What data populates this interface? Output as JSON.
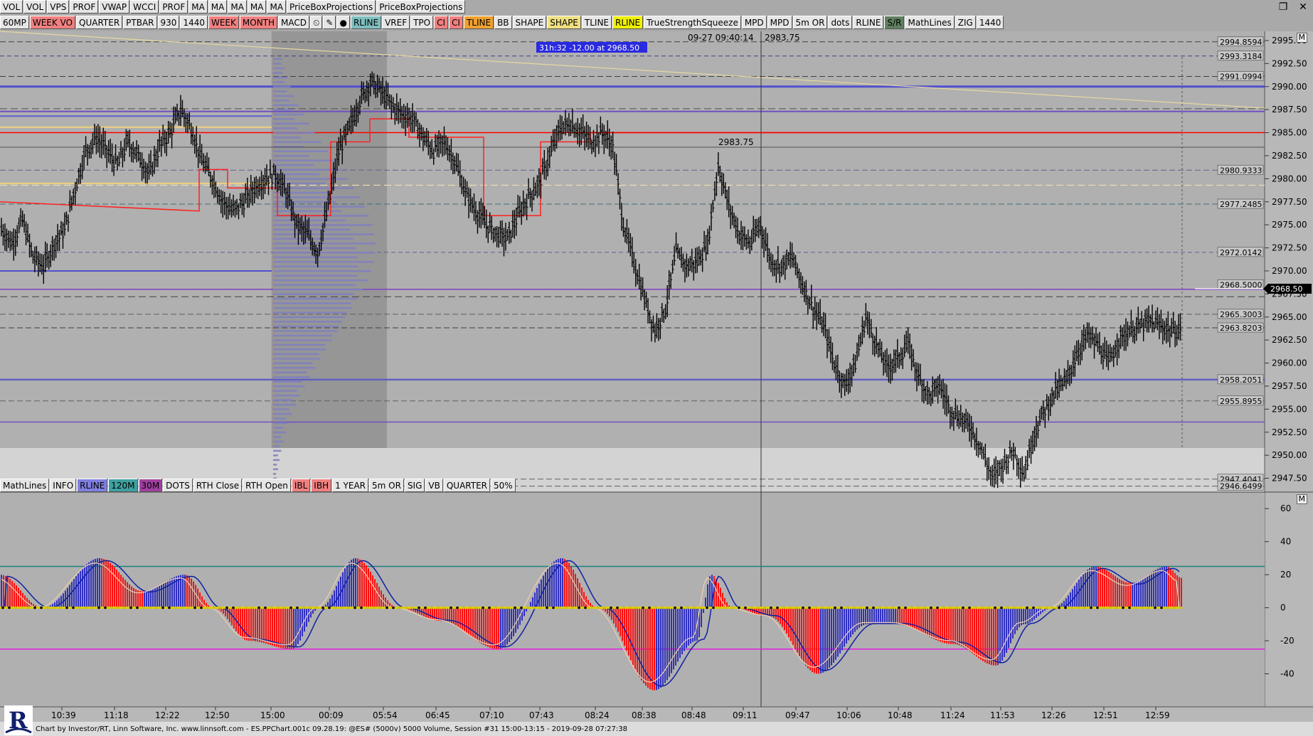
{
  "toolbar_top": [
    "VOL",
    "VOL",
    "VPS",
    "PROF",
    "VWAP",
    "WCCI",
    "PROF",
    "MA",
    "MA",
    "MA",
    "MA",
    "MA",
    "PriceBoxProjections",
    "PriceBoxProjections"
  ],
  "toolbar_second": [
    {
      "label": "60MP",
      "bg": "#e6e6e6"
    },
    {
      "label": "WEEK VO",
      "bg": "#f08080"
    },
    {
      "label": "QUARTER",
      "bg": "#e6e6e6"
    },
    {
      "label": "PTBAR",
      "bg": "#e6e6e6"
    },
    {
      "label": "930",
      "bg": "#e6e6e6"
    },
    {
      "label": "1440",
      "bg": "#e6e6e6"
    },
    {
      "label": "WEEK",
      "bg": "#f08080"
    },
    {
      "label": "MONTH",
      "bg": "#f08080"
    },
    {
      "label": "MACD",
      "bg": "#e6e6e6"
    },
    {
      "label": "⏲",
      "bg": "#e6e6e6"
    },
    {
      "label": "✎",
      "bg": "#e6e6e6"
    },
    {
      "label": "●",
      "bg": "#e6e6e6"
    },
    {
      "label": "RLINE",
      "bg": "#7fbfbf"
    },
    {
      "label": "VREF",
      "bg": "#e6e6e6"
    },
    {
      "label": "TPO",
      "bg": "#e6e6e6"
    },
    {
      "label": "CI",
      "bg": "#f08080"
    },
    {
      "label": "CI",
      "bg": "#f08080"
    },
    {
      "label": "TLINE",
      "bg": "#f0a030"
    },
    {
      "label": "BB",
      "bg": "#e6e6e6"
    },
    {
      "label": "SHAPE",
      "bg": "#e6e6e6"
    },
    {
      "label": "SHAPE",
      "bg": "#f0e080"
    },
    {
      "label": "TLINE",
      "bg": "#e6e6e6"
    },
    {
      "label": "RLINE",
      "bg": "#f0f000"
    },
    {
      "label": "TrueStrengthSqueeze",
      "bg": "#e6e6e6"
    },
    {
      "label": "MPD",
      "bg": "#e6e6e6"
    },
    {
      "label": "MPD",
      "bg": "#e6e6e6"
    },
    {
      "label": "5m OR",
      "bg": "#e6e6e6"
    },
    {
      "label": "dots",
      "bg": "#e6e6e6"
    },
    {
      "label": "RLINE",
      "bg": "#e6e6e6"
    },
    {
      "label": "S/R",
      "bg": "#608060"
    },
    {
      "label": "MathLines",
      "bg": "#e6e6e6"
    },
    {
      "label": "ZIG",
      "bg": "#e6e6e6"
    },
    {
      "label": "1440",
      "bg": "#e6e6e6"
    }
  ],
  "toolbar_lower": [
    {
      "label": "MathLines",
      "bg": "#e6e6e6"
    },
    {
      "label": "INFO",
      "bg": "#e6e6e6"
    },
    {
      "label": "RLINE",
      "bg": "#7f7fe0"
    },
    {
      "label": "120M",
      "bg": "#40a0a0"
    },
    {
      "label": "30M",
      "bg": "#a040a0"
    },
    {
      "label": "DOTS",
      "bg": "#e6e6e6"
    },
    {
      "label": "RTH Close",
      "bg": "#e6e6e6"
    },
    {
      "label": "RTH Open",
      "bg": "#e6e6e6"
    },
    {
      "label": "IBL",
      "bg": "#f08080"
    },
    {
      "label": "IBH",
      "bg": "#f08080"
    },
    {
      "label": "1 YEAR",
      "bg": "#e6e6e6"
    },
    {
      "label": "5m OR",
      "bg": "#e6e6e6"
    },
    {
      "label": "SIG",
      "bg": "#e6e6e6"
    },
    {
      "label": "VB",
      "bg": "#e6e6e6"
    },
    {
      "label": "QUARTER",
      "bg": "#e6e6e6"
    },
    {
      "label": "50%",
      "bg": "#e6e6e6"
    }
  ],
  "window_controls": {
    "restore": "❐",
    "close": "✕"
  },
  "header_info": {
    "cursor_time": "09-27 09:40:14",
    "cursor_price": "2983.75",
    "measure_label": "31h:32  -12.00 at 2968.50",
    "price_marker": "2983.75",
    "current_price": "2968.50"
  },
  "colors": {
    "background": "#a9a9a9",
    "bar": "#000000",
    "red_level": "#ff0000",
    "yellow_level": "#f0d080",
    "blue_level": "#6060e0",
    "osc_blue": "#3030c0",
    "osc_red": "#ff1010",
    "osc_teal": "#208080",
    "osc_magenta": "#e020e0",
    "profile": "#8080c0"
  },
  "price_axis": {
    "min": 2946,
    "max": 2996,
    "ticks": [
      "2995.00",
      "2992.50",
      "2990.00",
      "2987.50",
      "2985.00",
      "2982.50",
      "2980.00",
      "2977.50",
      "2975.00",
      "2972.50",
      "2970.00",
      "2967.50",
      "2965.00",
      "2962.50",
      "2960.00",
      "2957.50",
      "2955.00",
      "2952.50",
      "2950.00",
      "2947.50"
    ],
    "level_labels": [
      "2994.8594",
      "2993.3184",
      "2991.0994",
      "2980.9333",
      "2977.2485",
      "2972.0142",
      "2968.5000",
      "2965.3003",
      "2963.8203",
      "2958.2051",
      "2955.8955",
      "2947.4041",
      "2946.6499"
    ]
  },
  "osc_axis": {
    "ticks": [
      "60",
      "40",
      "20",
      "0",
      "-20",
      "-40"
    ]
  },
  "time_axis": {
    "labels": [
      "10:39",
      "11:18",
      "12:22",
      "12:50",
      "15:00",
      "00:09",
      "05:54",
      "06:45",
      "07:10",
      "07:43",
      "08:24",
      "08:38",
      "08:48",
      "09:11",
      "09:47",
      "10:06",
      "10:48",
      "11:24",
      "11:53",
      "12:26",
      "12:51",
      "12:59"
    ]
  },
  "chart_data": {
    "type": "ohlc",
    "close_path": [
      2974.5,
      2973,
      2975.5,
      2971.5,
      2970.5,
      2973,
      2974.5,
      2979,
      2983,
      2984.5,
      2983,
      2981.5,
      2984,
      2982.5,
      2980.5,
      2983.5,
      2985,
      2987.5,
      2985.5,
      2982,
      2980,
      2977.5,
      2976.5,
      2977.5,
      2979,
      2980,
      2980.5,
      2978.5,
      2975,
      2974,
      2972,
      2977,
      2983,
      2985.5,
      2988.5,
      2990.5,
      2989.5,
      2988,
      2987,
      2986.5,
      2984.5,
      2983,
      2984,
      2982,
      2978.5,
      2976.5,
      2975,
      2974,
      2973.5,
      2976,
      2978,
      2979.5,
      2982.5,
      2985.5,
      2986,
      2985,
      2984,
      2985,
      2983.5,
      2975,
      2971,
      2967,
      2963.5,
      2966,
      2972,
      2970.5,
      2971,
      2973,
      2981.5,
      2977,
      2974,
      2973,
      2975,
      2971,
      2970.5,
      2971.5,
      2968.5,
      2966,
      2964,
      2960,
      2957.5,
      2960,
      2965,
      2962,
      2959.5,
      2960.5,
      2962,
      2958.5,
      2956.5,
      2957.5,
      2955,
      2954,
      2953,
      2950.5,
      2947.5,
      2949,
      2950.5,
      2948,
      2952.5,
      2955,
      2957,
      2958,
      2961,
      2963,
      2962,
      2960,
      2962.5,
      2963.5,
      2964,
      2964.5,
      2964,
      2963.5
    ]
  },
  "footer": {
    "text": "Chart by Investor/RT, Linn Software, Inc. www.linnsoft.com - ES.PPChart.001c  09.28.19: @ES# (5000v) 5000 Volume, Session #31 15:00-13:15 - 2019-09-28 07:27:38",
    "logo_letter": "R",
    "pane_button": "M"
  }
}
